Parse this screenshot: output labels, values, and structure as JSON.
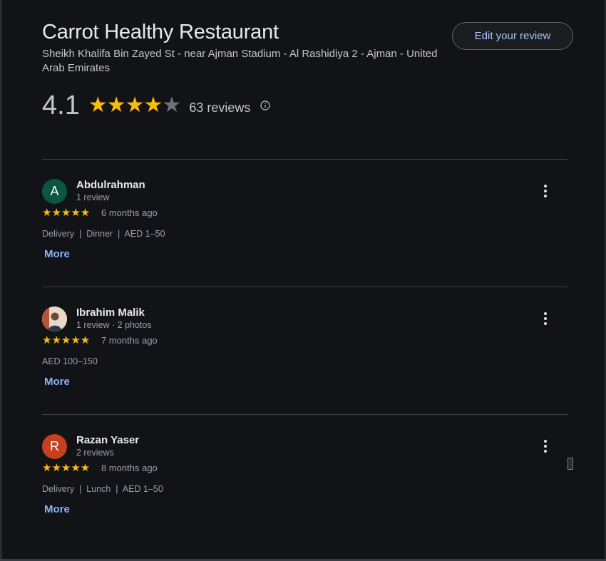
{
  "place": {
    "title": "Carrot Healthy Restaurant",
    "address": "Sheikh Khalifa Bin Zayed St - near Ajman Stadium - Al Rashidiya 2 - Ajman - United Arab Emirates",
    "edit_review_label": "Edit your review",
    "rating": "4.1",
    "rating_value": 4.1,
    "stars_filled": 4,
    "stars_total": 5,
    "review_count": "63 reviews",
    "info_icon": "info-icon"
  },
  "colors": {
    "background": "#121317",
    "star": "#fbbc04",
    "star_empty": "#6f7276",
    "link": "#8ab4f8",
    "edit_button_text": "#a8c7fa"
  },
  "reviews": [
    {
      "name": "Abdulrahman",
      "meta": "1 review",
      "avatar_letter": "A",
      "avatar_color": "#0b5543",
      "avatar_type": "letter",
      "stars": 5,
      "time": "6 months ago",
      "tags": "Delivery  |  Dinner  |  AED 1–50",
      "more_label": "More"
    },
    {
      "name": "Ibrahim Malik",
      "meta": "1 review · 2 photos",
      "avatar_letter": "",
      "avatar_color": "#d9b8a0",
      "avatar_type": "photo",
      "stars": 5,
      "time": "7 months ago",
      "tags": "AED 100–150",
      "more_label": "More"
    },
    {
      "name": "Razan Yaser",
      "meta": "2 reviews",
      "avatar_letter": "R",
      "avatar_color": "#c5401f",
      "avatar_type": "letter",
      "stars": 5,
      "time": "8 months ago",
      "tags": "Delivery  |  Lunch  |  AED 1–50",
      "more_label": "More"
    }
  ]
}
